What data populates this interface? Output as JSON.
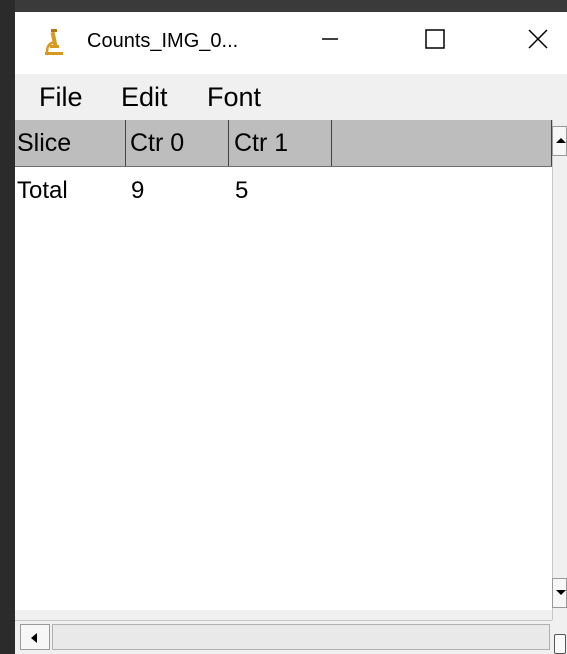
{
  "window": {
    "title": "Counts_IMG_0..."
  },
  "icons": {
    "app": "microscope-icon",
    "minimize": "minimize-icon",
    "maximize": "maximize-icon",
    "close": "close-icon"
  },
  "menu": {
    "items": [
      "File",
      "Edit",
      "Font"
    ]
  },
  "table": {
    "headers": [
      "Slice",
      "Ctr 0",
      "Ctr 1"
    ],
    "rows": [
      [
        "Total",
        "9",
        "5"
      ]
    ]
  },
  "colors": {
    "header_bg": "#bdbdbd",
    "icon_accent": "#d89a1e"
  }
}
